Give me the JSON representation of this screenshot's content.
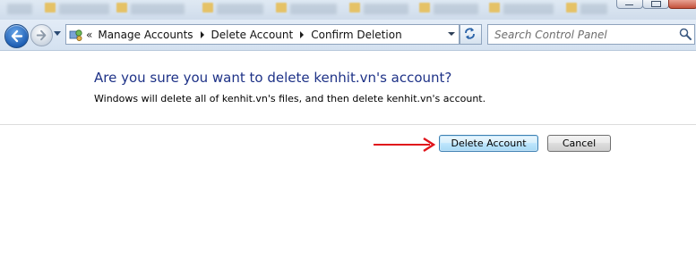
{
  "window": {
    "background_tabs": [
      "",
      "",
      "",
      "",
      "",
      "",
      "",
      "",
      ""
    ]
  },
  "navbar": {
    "back_icon": "back-arrow-icon",
    "forward_icon": "forward-arrow-icon",
    "address_overflow": "«",
    "breadcrumbs": [
      {
        "label": "Manage Accounts"
      },
      {
        "label": "Delete Account"
      },
      {
        "label": "Confirm Deletion"
      }
    ],
    "search": {
      "placeholder": "Search Control Panel",
      "value": ""
    }
  },
  "dialog": {
    "question": "Are you sure you want to delete kenhit.vn's account?",
    "explanation": "Windows will delete all of kenhit.vn's files, and then delete kenhit.vn's account.",
    "buttons": {
      "delete_label": "Delete Account",
      "cancel_label": "Cancel"
    }
  },
  "colors": {
    "question_text": "#1e3287",
    "annotation_arrow": "#e0141b",
    "primary_button_border": "#3c7fb1"
  }
}
